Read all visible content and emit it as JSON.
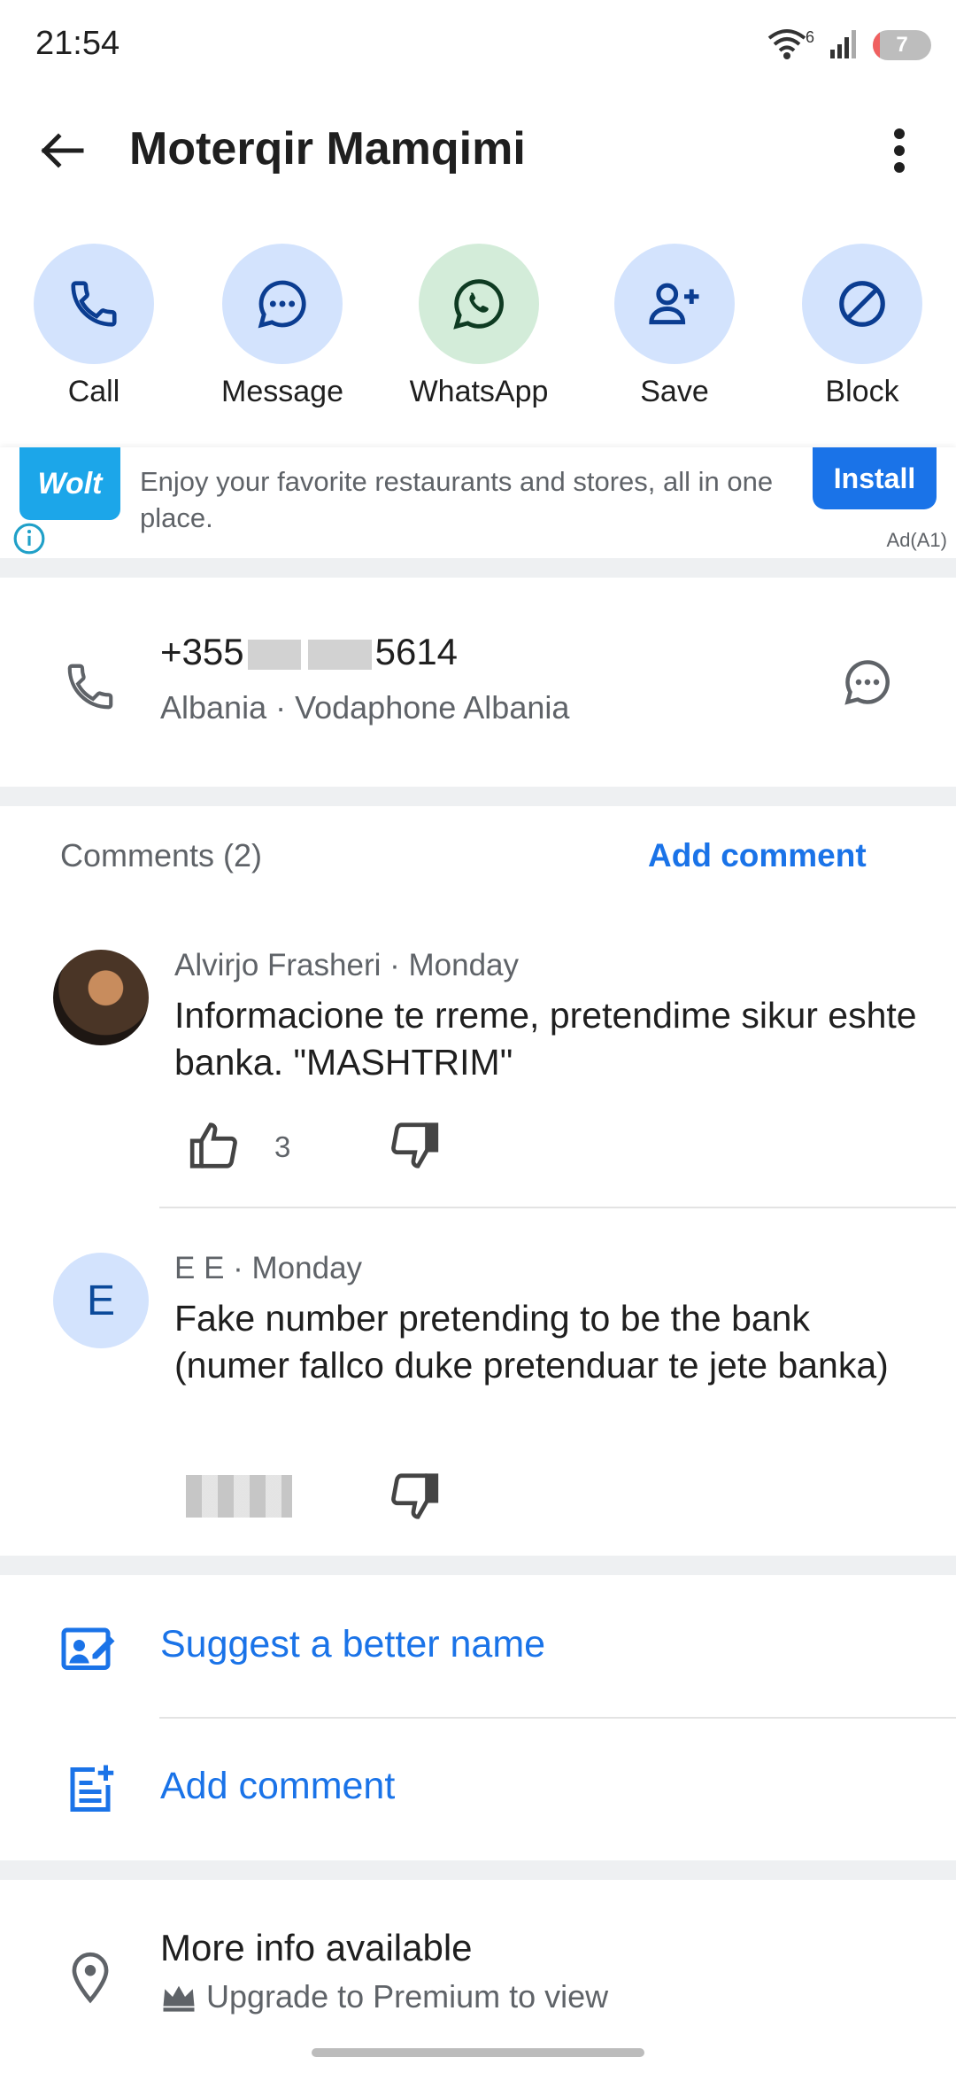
{
  "status_bar": {
    "time": "21:54",
    "battery": "7",
    "wifi_badge": "6"
  },
  "header": {
    "title": "Moterqir Mamqimi",
    "back_icon": "arrow-back-icon",
    "more_icon": "more-vert-icon"
  },
  "actions": [
    {
      "label": "Call",
      "icon": "phone-icon"
    },
    {
      "label": "Message",
      "icon": "chat-bubble-icon"
    },
    {
      "label": "WhatsApp",
      "icon": "whatsapp-icon"
    },
    {
      "label": "Save",
      "icon": "person-add-icon"
    },
    {
      "label": "Block",
      "icon": "block-icon"
    }
  ],
  "ad": {
    "brand": "Wolt",
    "text": "Enjoy your favorite restaurants and stores, all in one place.",
    "button": "Install",
    "label": "Ad(A1)"
  },
  "number": {
    "prefix": "+355",
    "suffix": "5614",
    "subtitle": "Albania · Vodaphone Albania"
  },
  "comments": {
    "title": "Comments (2)",
    "add_label": "Add comment",
    "items": [
      {
        "meta": "Alvirjo Frasheri · Monday",
        "body": "Informacione te rreme, pretendime sikur eshte banka. \"MASHTRIM\"",
        "likes": "3"
      },
      {
        "avatar_letter": "E",
        "meta": "E E · Monday",
        "body": "Fake number pretending to be the bank (numer fallco duke pretenduar te jete banka)"
      }
    ]
  },
  "list": {
    "suggest_label": "Suggest a better name",
    "add_comment_label": "Add comment"
  },
  "more_info": {
    "title": "More info available",
    "subtitle": "Upgrade to Premium to view"
  },
  "colors": {
    "accent": "#1a73e8",
    "action_bg": "#d3e3fd",
    "whatsapp_bg": "#d3ecd9",
    "icon_dark": "#0b3d91"
  }
}
